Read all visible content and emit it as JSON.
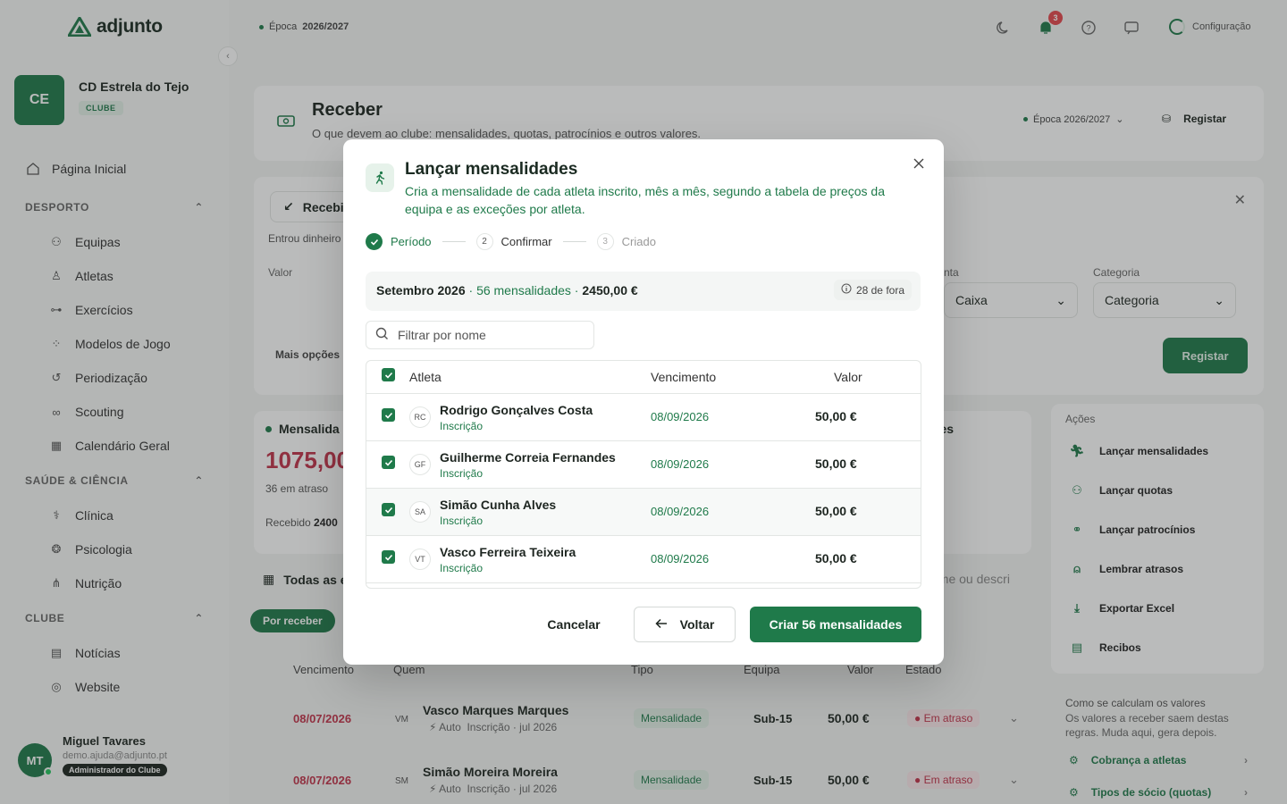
{
  "app": {
    "name": "adjunto",
    "season_prefix": "Época",
    "season": "2026/2027",
    "notifications": "3",
    "config_label": "Configuração"
  },
  "club": {
    "initials": "CE",
    "name": "CD Estrela do Tejo",
    "tag": "CLUBE"
  },
  "nav": {
    "home": "Página Inicial",
    "sections": [
      {
        "title": "DESPORTO",
        "items": [
          "Equipas",
          "Atletas",
          "Exercícios",
          "Modelos de Jogo",
          "Periodização",
          "Scouting",
          "Calendário Geral"
        ]
      },
      {
        "title": "SAÚDE & CIÊNCIA",
        "items": [
          "Clínica",
          "Psicologia",
          "Nutrição"
        ]
      },
      {
        "title": "CLUBE",
        "items": [
          "Notícias",
          "Website"
        ]
      }
    ]
  },
  "user": {
    "initials": "MT",
    "name": "Miguel Tavares",
    "email": "demo.ajuda@adjunto.pt",
    "role": "Administrador do Clube"
  },
  "page": {
    "title": "Receber",
    "subtitle": "O que devem ao clube: mensalidades, quotas, patrocínios e outros valores.",
    "season_label": "Época 2026/2027",
    "register_label": "Registar"
  },
  "receive_panel": {
    "tab_label": "Recebi",
    "hint": "Entrou dinheiro",
    "value_label": "Valor",
    "account_label": "nta",
    "account_value": "Caixa",
    "category_label": "Categoria",
    "category_value": "Categoria",
    "more_options": "Mais opções",
    "register_button": "Registar"
  },
  "stats": {
    "title": "Mensalida",
    "amount": "1075,00",
    "late": "36 em atraso",
    "received_prefix": "Recebido",
    "received_value": "2400",
    "right_title": "res"
  },
  "actions": {
    "title": "Ações",
    "items": [
      "Lançar mensalidades",
      "Lançar quotas",
      "Lançar patrocínios",
      "Lembrar atrasos",
      "Exportar Excel",
      "Recibos"
    ]
  },
  "help": {
    "title": "Como se calculam os valores",
    "desc": "Os valores a receber saem destas regras. Muda aqui, gera depois.",
    "links": [
      "Cobrança a atletas",
      "Tipos de sócio (quotas)"
    ]
  },
  "list": {
    "title": "Todas as e",
    "search_partial": "ome ou descri",
    "chip": "Por receber",
    "columns": [
      "Vencimento",
      "Quem",
      "Tipo",
      "Equipa",
      "Valor",
      "Estado"
    ],
    "rows": [
      {
        "date": "08/07/2026",
        "initials": "VM",
        "name": "Vasco Marques Marques",
        "auto": "Auto",
        "sub": "Inscrição · jul 2026",
        "type": "Mensalidade",
        "team": "Sub-15",
        "value": "50,00 €",
        "state": "Em atraso"
      },
      {
        "date": "08/07/2026",
        "initials": "SM",
        "name": "Simão Moreira Moreira",
        "auto": "Auto",
        "sub": "Inscrição · jul 2026",
        "type": "Mensalidade",
        "team": "Sub-15",
        "value": "50,00 €",
        "state": "Em atraso"
      }
    ]
  },
  "modal": {
    "title": "Lançar mensalidades",
    "description": "Cria a mensalidade de cada atleta inscrito, mês a mês, segundo a tabela de preços da equipa e as exceções por atleta.",
    "steps": [
      {
        "num": "1",
        "label": "Período"
      },
      {
        "num": "2",
        "label": "Confirmar"
      },
      {
        "num": "3",
        "label": "Criado"
      }
    ],
    "summary": {
      "period": "Setembro 2026",
      "count": "56 mensalidades",
      "total": "2450,00 €",
      "excluded": "28 de fora"
    },
    "filter_placeholder": "Filtrar por nome",
    "table": {
      "col_athlete": "Atleta",
      "col_due": "Vencimento",
      "col_value": "Valor",
      "rows": [
        {
          "initials": "RC",
          "name": "Rodrigo Gonçalves Costa",
          "sub": "Inscrição",
          "due": "08/09/2026",
          "value": "50,00 €"
        },
        {
          "initials": "GF",
          "name": "Guilherme Correia Fernandes",
          "sub": "Inscrição",
          "due": "08/09/2026",
          "value": "50,00 €"
        },
        {
          "initials": "SA",
          "name": "Simão Cunha Alves",
          "sub": "Inscrição",
          "due": "08/09/2026",
          "value": "50,00 €"
        },
        {
          "initials": "VT",
          "name": "Vasco Ferreira Teixeira",
          "sub": "Inscrição",
          "due": "08/09/2026",
          "value": "50,00 €"
        }
      ]
    },
    "buttons": {
      "cancel": "Cancelar",
      "back": "Voltar",
      "create": "Criar 56 mensalidades"
    }
  },
  "colors": {
    "brand": "#1f7a4a",
    "danger": "#c2334a"
  }
}
